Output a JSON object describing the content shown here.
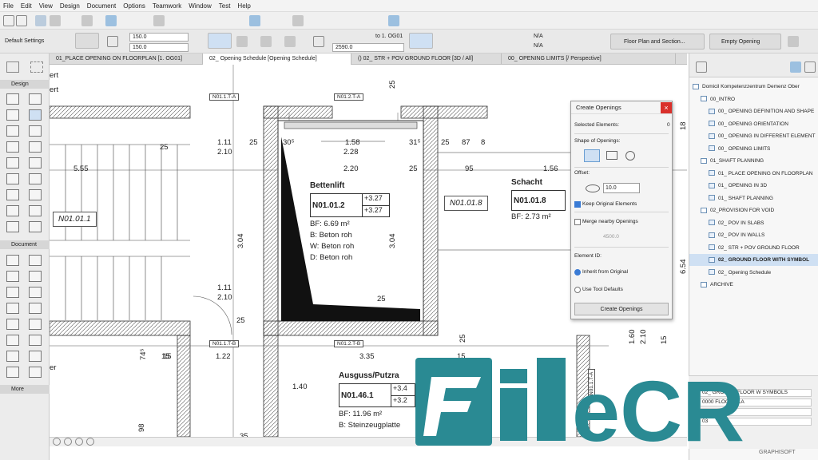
{
  "menu": [
    "File",
    "Edit",
    "View",
    "Design",
    "Document",
    "Options",
    "Teamwork",
    "Window",
    "Test",
    "Help"
  ],
  "infobar": {
    "default_settings": "Default Settings",
    "field1": "150.0",
    "field2": "150.0",
    "story": "to 1. OG01",
    "field3": "2590.0",
    "na1": "N/A",
    "na2": "N/A",
    "floor_plan_btn": "Floor Plan and Section...",
    "opening_btn": "Empty Opening"
  },
  "toolbox": {
    "design": "Design",
    "document": "Document",
    "more": "More"
  },
  "tabs": [
    "01_PLACE OPENING ON FLOORPLAN [1. OG01]",
    "02_ Opening Schedule [Opening Schedule]",
    "() 02_ STR + POV GROUND FLOOR [3D / All]",
    "00_ OPENING LIMITS [/ Perspective]"
  ],
  "drawing": {
    "corner_texts": [
      "ert",
      "ert",
      "er"
    ],
    "wall_tags": [
      "N01.1.T-A",
      "N01.2.T-A",
      "N01.1.T-B",
      "N01.2.T-B",
      "N01.1.T-A",
      "N01.1.T-A"
    ],
    "dims": [
      "1.11",
      "2.10",
      "25",
      "30⁵",
      "1.58",
      "2.28",
      "31⁵",
      "25",
      "87",
      "8",
      "2.20",
      "25",
      "95",
      "1.56",
      "5.55",
      "3.04",
      "3.04",
      "1.11",
      "2.10",
      "25",
      "25",
      "1.22",
      "15",
      "3.35",
      "15",
      "74⁵",
      "98",
      "1.40",
      "35",
      "25",
      "6.54",
      "18",
      "1.60",
      "2.10",
      "15",
      "25",
      "25",
      "15"
    ],
    "room_tags": [
      "N01.01.1",
      "N01.01.8"
    ],
    "bettenlift": {
      "name": "Bettenlift",
      "id": "N01.01.2",
      "lvl1": "+3.27",
      "lvl2": "+3.27",
      "area": "BF: 6.69 m²",
      "b": "B: Beton roh",
      "w": "W: Beton roh",
      "d": "D: Beton roh"
    },
    "schacht": {
      "name": "Schacht",
      "id": "N01.01.8",
      "area": "BF: 2.73 m²"
    },
    "ausguss": {
      "name": "Ausguss/Putzra",
      "id": "N01.46.1",
      "lvl1": "+3.4",
      "lvl2": "+3.2",
      "area": "BF: 11.96 m²",
      "b": "B: Steinzeugplatte"
    }
  },
  "dialog": {
    "title": "Create Openings",
    "selected_label": "Selected Elements:",
    "selected_count": "0",
    "shape_label": "Shape of Openings:",
    "offset_label": "Offset:",
    "offset_value": "10.0",
    "keep_original": "Keep Original Elements",
    "merge": "Merge nearby Openings",
    "merge_value": "4500.0",
    "element_id_label": "Element ID:",
    "inherit": "Inherit from Original",
    "use_defaults": "Use Tool Defaults",
    "create_button": "Create Openings"
  },
  "navigator": {
    "items": [
      {
        "label": "Domicil Kompetenzzentrum Demenz Ober",
        "depth": 0
      },
      {
        "label": "00_INTRO",
        "depth": 1
      },
      {
        "label": "00_ OPENING DEFINITION AND SHAPE",
        "depth": 2
      },
      {
        "label": "00_ OPENING ORIENTATION",
        "depth": 2
      },
      {
        "label": "00_ OPENING IN DIFFERENT ELEMENT",
        "depth": 2
      },
      {
        "label": "00_ OPENING LIMITS",
        "depth": 2
      },
      {
        "label": "01_SHAFT PLANNING",
        "depth": 1
      },
      {
        "label": "01_ PLACE OPENING ON FLOORPLAN",
        "depth": 2
      },
      {
        "label": "01_ OPENING IN 3D",
        "depth": 2
      },
      {
        "label": "01_ SHAFT PLANNING",
        "depth": 2
      },
      {
        "label": "02_PROVISION FOR VOID",
        "depth": 1
      },
      {
        "label": "02_ POV IN SLABS",
        "depth": 2
      },
      {
        "label": "02_ POV IN WALLS",
        "depth": 2
      },
      {
        "label": "02_ STR + POV GROUND FLOOR",
        "depth": 2
      },
      {
        "label": "02_ GROUND FLOOR WITH SYMBOL",
        "depth": 2,
        "selected": true
      },
      {
        "label": "02_ Opening Schedule",
        "depth": 2
      },
      {
        "label": "ARCHIVE",
        "depth": 1
      }
    ]
  },
  "props": {
    "rows": [
      "02_    GROUND FLOOR W    SYMBOLS",
      "0000 FLOOR PLA",
      "1:50",
      "03"
    ]
  },
  "watermark": {
    "text": "FileCR",
    "color": "#2a8a93"
  },
  "graphisoft": "GRAPHISOFT"
}
